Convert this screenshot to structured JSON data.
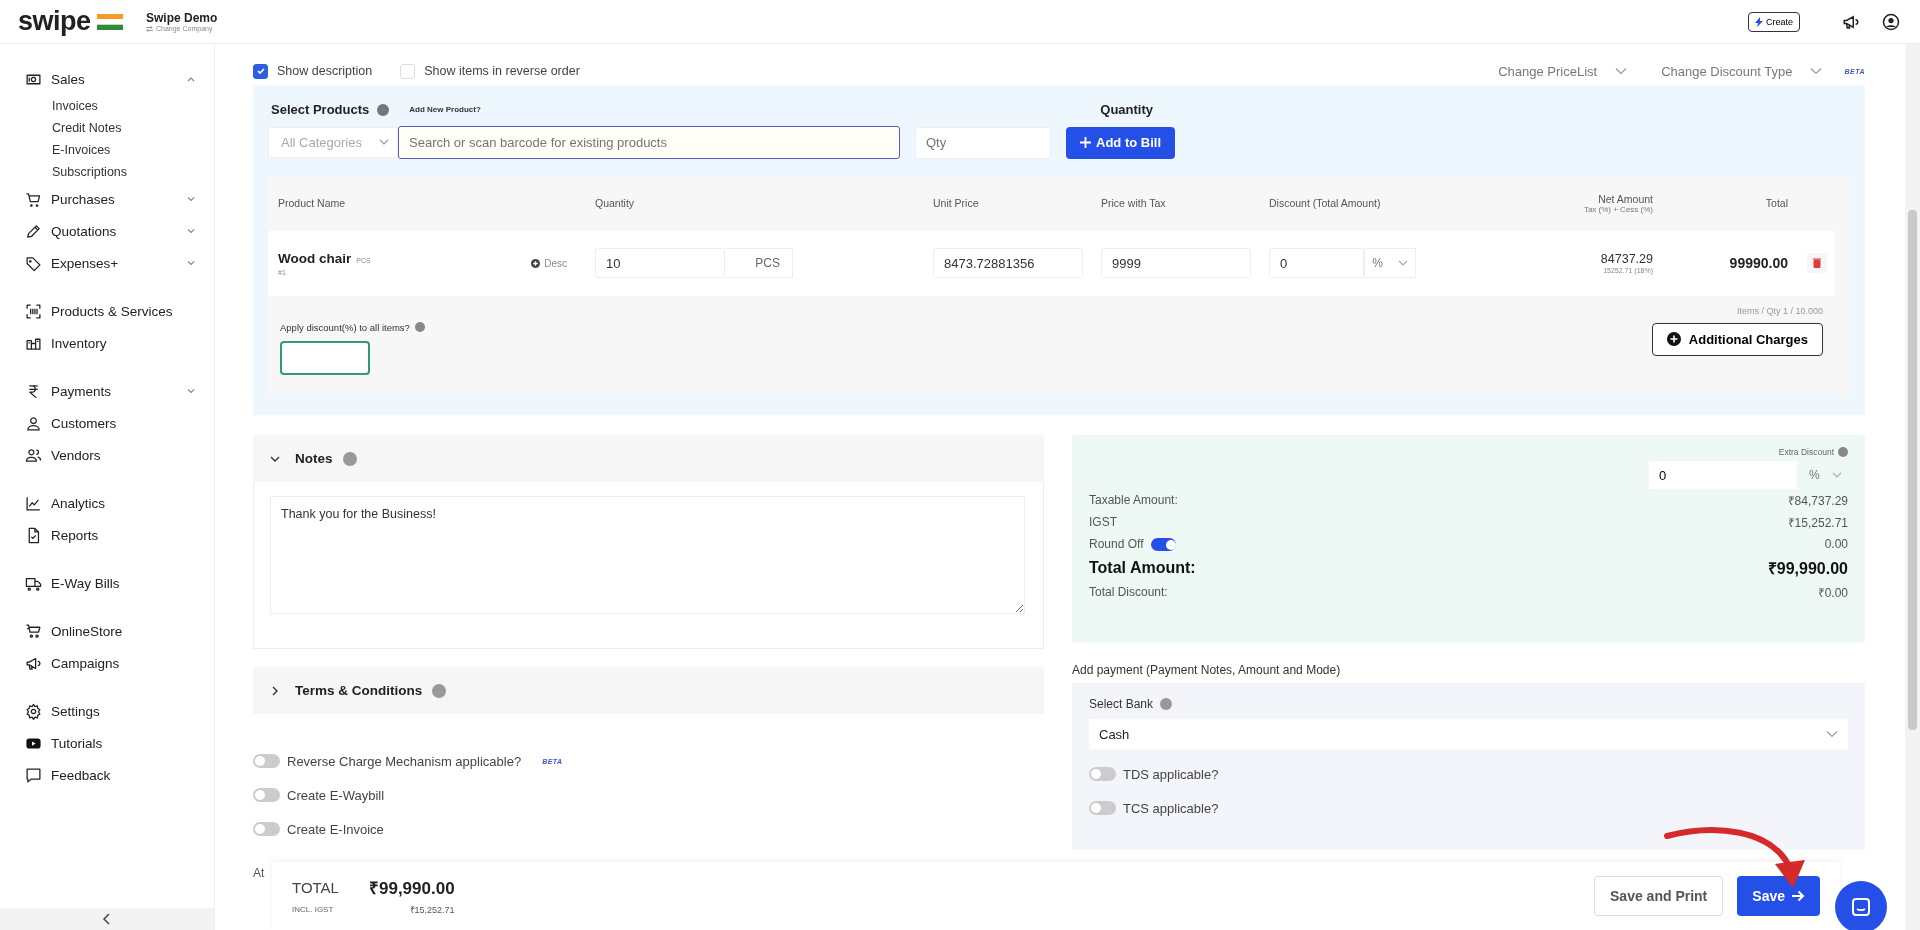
{
  "header": {
    "logo": "swipe",
    "company": "Swipe Demo",
    "company_link": "Change Company",
    "create_button": "Create"
  },
  "sidebar": {
    "groups": [
      [
        {
          "label": "Sales",
          "expanded": true,
          "children": [
            {
              "label": "Invoices"
            },
            {
              "label": "Credit Notes"
            },
            {
              "label": "E-Invoices"
            },
            {
              "label": "Subscriptions"
            }
          ]
        },
        {
          "label": "Purchases",
          "expanded": false
        },
        {
          "label": "Quotations",
          "expanded": false
        },
        {
          "label": "Expenses+",
          "expanded": false
        }
      ],
      [
        {
          "label": "Products & Services"
        },
        {
          "label": "Inventory"
        }
      ],
      [
        {
          "label": "Payments",
          "expanded": false
        },
        {
          "label": "Customers"
        },
        {
          "label": "Vendors"
        }
      ],
      [
        {
          "label": "Analytics"
        },
        {
          "label": "Reports"
        }
      ],
      [
        {
          "label": "E-Way Bills"
        }
      ],
      [
        {
          "label": "OnlineStore"
        },
        {
          "label": "Campaigns"
        }
      ],
      [
        {
          "label": "Settings"
        },
        {
          "label": "Tutorials"
        },
        {
          "label": "Feedback"
        }
      ]
    ]
  },
  "options": {
    "checkboxes": [
      {
        "label": "Show description",
        "checked": true
      },
      {
        "label": "Show items in reverse order",
        "checked": false
      }
    ],
    "selects": [
      {
        "placeholder": "Change PriceList"
      },
      {
        "placeholder": "Change Discount Type"
      }
    ],
    "badge": "BETA"
  },
  "product_picker": {
    "label": "Select Products",
    "link": "Add New Product?",
    "category": "All Categories",
    "search": {
      "placeholder": "Search or scan barcode for existing products"
    },
    "quantity_label": "Quantity",
    "quantity": {
      "placeholder": "Qty"
    },
    "add_button": "Add to Bill"
  },
  "table": {
    "columns": [
      {
        "label": "Product Name"
      },
      {
        "label": "Quantity"
      },
      {
        "label": "Unit Price"
      },
      {
        "label": "Price with Tax"
      },
      {
        "label": "Discount (Total Amount)"
      },
      {
        "label": "Net Amount",
        "sublabel": "Tax (%) + Cess (%)"
      },
      {
        "label": "Total"
      }
    ],
    "rows": [
      {
        "name": "Wood chair",
        "unit": "PCS",
        "sku": "#1",
        "desc_button": "Desc",
        "quantity": "10",
        "quantity_unit": "PCS",
        "unit_price": "8473.72881356",
        "price_with_tax": "9999",
        "discount": "0",
        "discount_type": "%",
        "net_amount": "84737.29",
        "tax": "15252.71 (18%)",
        "total": "99990.00"
      }
    ]
  },
  "items_summary": "Items / Qty 1 / 10.000",
  "apply_discount": {
    "label": "Apply discount(%) to all items?"
  },
  "additional_charges_button": "Additional Charges",
  "notes": {
    "title": "Notes",
    "expanded": true,
    "text": "Thank you for the Business!"
  },
  "terms": {
    "title": "Terms & Conditions",
    "expanded": false
  },
  "toggles": [
    {
      "label": "Reverse Charge Mechanism applicable?",
      "on": false,
      "badge": "BETA"
    },
    {
      "label": "Create E-Waybill",
      "on": false
    },
    {
      "label": "Create E-Invoice",
      "on": false
    }
  ],
  "attachments_label": "At",
  "summary": {
    "extra_discount": {
      "label": "Extra Discount",
      "value": "0",
      "type": "%"
    },
    "lines": [
      {
        "label": "Taxable Amount:",
        "value": "₹84,737.29",
        "kind": "normal"
      },
      {
        "label": "IGST",
        "value": "₹15,252.71",
        "kind": "normal"
      },
      {
        "label": "Round Off",
        "value": "0.00",
        "kind": "toggle",
        "on": true
      },
      {
        "label": "Total Amount:",
        "value": "₹99,990.00",
        "kind": "total"
      },
      {
        "label": "Total Discount:",
        "value": "₹0.00",
        "kind": "discount"
      }
    ]
  },
  "payment": {
    "title": "Add payment (Payment Notes, Amount and Mode)",
    "bank_label": "Select Bank",
    "bank": "Cash",
    "toggles": [
      {
        "label": "TDS applicable?",
        "on": false
      },
      {
        "label": "TCS applicable?",
        "on": false
      }
    ]
  },
  "footer": {
    "total_label": "TOTAL",
    "total": "₹99,990.00",
    "tax_label": "INCL. IGST",
    "tax": "₹15,252.71",
    "buttons": [
      {
        "label": "Save and Print",
        "kind": "secondary"
      },
      {
        "label": "Save",
        "kind": "primary"
      }
    ]
  }
}
